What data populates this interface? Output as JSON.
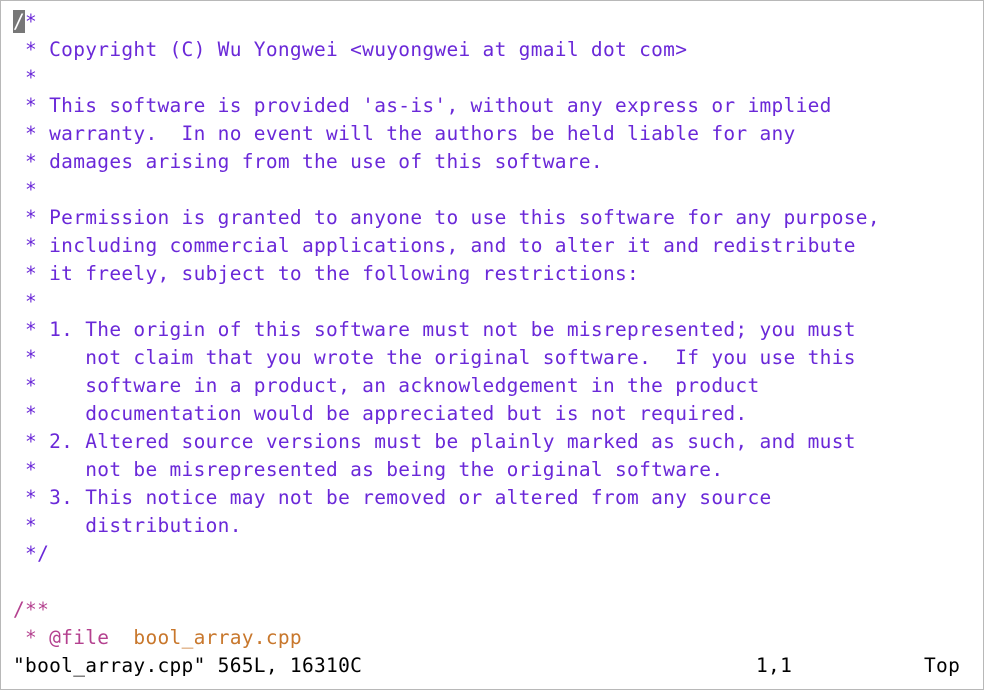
{
  "editor": {
    "lines": [
      {
        "parts": [
          {
            "text": "/",
            "cls": "comment cursor"
          },
          {
            "text": "*",
            "cls": "comment"
          }
        ]
      },
      {
        "parts": [
          {
            "text": " * Copyright (C) Wu Yongwei <wuyongwei at gmail dot com>",
            "cls": "comment"
          }
        ]
      },
      {
        "parts": [
          {
            "text": " *",
            "cls": "comment"
          }
        ]
      },
      {
        "parts": [
          {
            "text": " * This software is provided 'as-is', without any express or implied",
            "cls": "comment"
          }
        ]
      },
      {
        "parts": [
          {
            "text": " * warranty.  In no event will the authors be held liable for any",
            "cls": "comment"
          }
        ]
      },
      {
        "parts": [
          {
            "text": " * damages arising from the use of this software.",
            "cls": "comment"
          }
        ]
      },
      {
        "parts": [
          {
            "text": " *",
            "cls": "comment"
          }
        ]
      },
      {
        "parts": [
          {
            "text": " * Permission is granted to anyone to use this software for any purpose,",
            "cls": "comment"
          }
        ]
      },
      {
        "parts": [
          {
            "text": " * including commercial applications, and to alter it and redistribute",
            "cls": "comment"
          }
        ]
      },
      {
        "parts": [
          {
            "text": " * it freely, subject to the following restrictions:",
            "cls": "comment"
          }
        ]
      },
      {
        "parts": [
          {
            "text": " *",
            "cls": "comment"
          }
        ]
      },
      {
        "parts": [
          {
            "text": " * 1. The origin of this software must not be misrepresented; you must",
            "cls": "comment"
          }
        ]
      },
      {
        "parts": [
          {
            "text": " *    not claim that you wrote the original software.  If you use this",
            "cls": "comment"
          }
        ]
      },
      {
        "parts": [
          {
            "text": " *    software in a product, an acknowledgement in the product",
            "cls": "comment"
          }
        ]
      },
      {
        "parts": [
          {
            "text": " *    documentation would be appreciated but is not required.",
            "cls": "comment"
          }
        ]
      },
      {
        "parts": [
          {
            "text": " * 2. Altered source versions must be plainly marked as such, and must",
            "cls": "comment"
          }
        ]
      },
      {
        "parts": [
          {
            "text": " *    not be misrepresented as being the original software.",
            "cls": "comment"
          }
        ]
      },
      {
        "parts": [
          {
            "text": " * 3. This notice may not be removed or altered from any source",
            "cls": "comment"
          }
        ]
      },
      {
        "parts": [
          {
            "text": " *    distribution.",
            "cls": "comment"
          }
        ]
      },
      {
        "parts": [
          {
            "text": " */",
            "cls": "comment"
          }
        ]
      },
      {
        "parts": [
          {
            "text": "",
            "cls": "comment"
          }
        ]
      },
      {
        "parts": [
          {
            "text": "/**",
            "cls": "keyword"
          }
        ]
      },
      {
        "parts": [
          {
            "text": " * ",
            "cls": "keyword"
          },
          {
            "text": "@file",
            "cls": "keyword"
          },
          {
            "text": "  bool_array.cpp",
            "cls": "filename"
          }
        ]
      }
    ]
  },
  "status": {
    "message": "\"bool_array.cpp\" 565L, 16310C",
    "position": "1,1",
    "scroll": "Top"
  },
  "colors": {
    "comment": "#6a28d8",
    "doc_keyword": "#b4418f",
    "filename": "#c8772c",
    "cursor": "#777777"
  }
}
